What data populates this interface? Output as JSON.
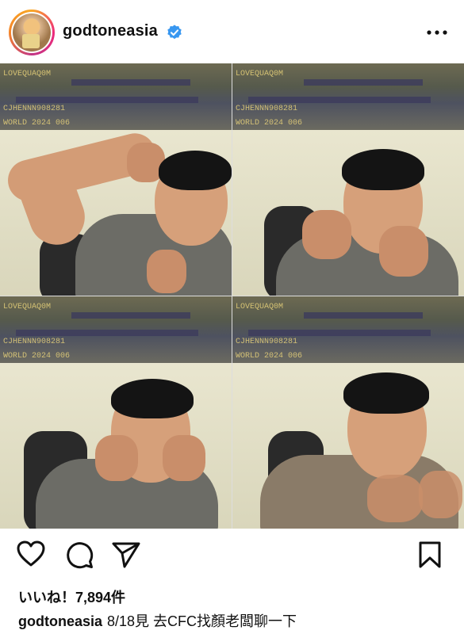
{
  "post": {
    "username": "godtoneasia",
    "verified": true,
    "likes_text": "いいね！7,894件",
    "caption_user": "godtoneasia",
    "caption_text": "8/18見 去CFC找顏老闆聊一下"
  },
  "stream_overlay": {
    "line1": "LOVEQUAQ0M",
    "line2": "CJHENNN908281",
    "line3": "WORLD 2024 006"
  },
  "icons": {
    "verified": "verified-badge-icon",
    "more": "more-dots-icon",
    "like": "heart-icon",
    "comment": "comment-icon",
    "share": "send-icon",
    "save": "bookmark-icon"
  },
  "colors": {
    "verified_blue": "#3897f0",
    "ring_start": "#f9a825",
    "ring_end": "#c13584"
  }
}
